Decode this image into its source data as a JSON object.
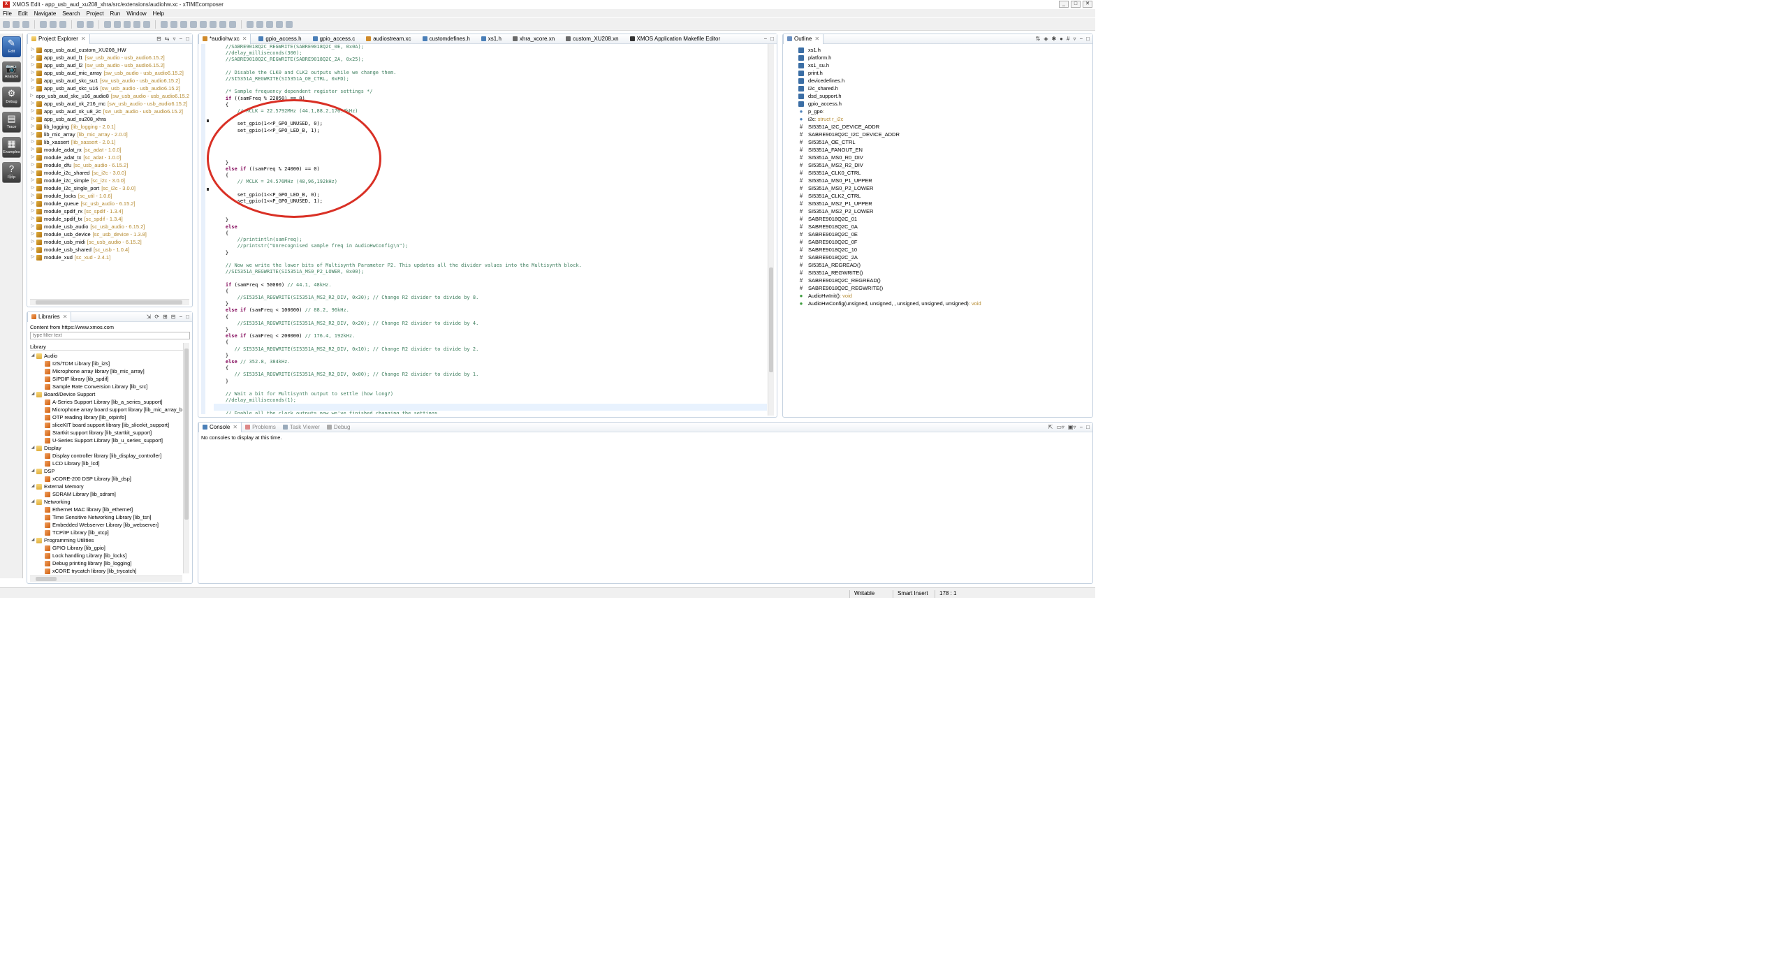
{
  "window": {
    "title": "XMOS Edit - app_usb_aud_xu208_xhra/src/extensions/audiohw.xc - xTIMEcomposer",
    "logo": "X",
    "buttons": [
      "_",
      "□",
      "✕"
    ]
  },
  "menu": [
    "File",
    "Edit",
    "Navigate",
    "Search",
    "Project",
    "Run",
    "Window",
    "Help"
  ],
  "perspectives": [
    {
      "label": "Edit",
      "icon": "✎",
      "active": true
    },
    {
      "label": "Analyze",
      "icon": "📷",
      "active": false
    },
    {
      "label": "Debug",
      "icon": "⚙",
      "active": false
    },
    {
      "label": "Trace",
      "icon": "▤",
      "active": false
    },
    {
      "label": "Examples",
      "icon": "▦",
      "active": false
    },
    {
      "label": "Help",
      "icon": "?",
      "active": false
    }
  ],
  "project_explorer": {
    "title": "Project Explorer",
    "items": [
      {
        "name": "app_usb_aud_custom_XU208_HW",
        "ver": ""
      },
      {
        "name": "app_usb_aud_l1",
        "ver": "[sw_usb_audio - usb_audio6.15.2]"
      },
      {
        "name": "app_usb_aud_l2",
        "ver": "[sw_usb_audio - usb_audio6.15.2]"
      },
      {
        "name": "app_usb_aud_mic_array",
        "ver": "[sw_usb_audio - usb_audio6.15.2]"
      },
      {
        "name": "app_usb_aud_skc_su1",
        "ver": "[sw_usb_audio - usb_audio6.15.2]"
      },
      {
        "name": "app_usb_aud_skc_u16",
        "ver": "[sw_usb_audio - usb_audio6.15.2]"
      },
      {
        "name": "app_usb_aud_skc_u16_audio8",
        "ver": "[sw_usb_audio - usb_audio6.15.2]"
      },
      {
        "name": "app_usb_aud_xk_216_mc",
        "ver": "[sw_usb_audio - usb_audio6.15.2]"
      },
      {
        "name": "app_usb_aud_xk_u8_2c",
        "ver": "[sw_usb_audio - usb_audio6.15.2]"
      },
      {
        "name": "app_usb_aud_xu208_xhra",
        "ver": ""
      },
      {
        "name": "lib_logging",
        "ver": "[lib_logging - 2.0.1]"
      },
      {
        "name": "lib_mic_array",
        "ver": "[lib_mic_array - 2.0.0]"
      },
      {
        "name": "lib_xassert",
        "ver": "[lib_xassert - 2.0.1]"
      },
      {
        "name": "module_adat_rx",
        "ver": "[sc_adat - 1.0.0]"
      },
      {
        "name": "module_adat_tx",
        "ver": "[sc_adat - 1.0.0]"
      },
      {
        "name": "module_dfu",
        "ver": "[sc_usb_audio - 6.15.2]"
      },
      {
        "name": "module_i2c_shared",
        "ver": "[sc_i2c - 3.0.0]"
      },
      {
        "name": "module_i2c_simple",
        "ver": "[sc_i2c - 3.0.0]"
      },
      {
        "name": "module_i2c_single_port",
        "ver": "[sc_i2c - 3.0.0]"
      },
      {
        "name": "module_locks",
        "ver": "[sc_util - 1.0.6]"
      },
      {
        "name": "module_queue",
        "ver": "[sc_usb_audio - 6.15.2]"
      },
      {
        "name": "module_spdif_rx",
        "ver": "[sc_spdif - 1.3.4]"
      },
      {
        "name": "module_spdif_tx",
        "ver": "[sc_spdif - 1.3.4]"
      },
      {
        "name": "module_usb_audio",
        "ver": "[sc_usb_audio - 6.15.2]"
      },
      {
        "name": "module_usb_device",
        "ver": "[sc_usb_device - 1.3.8]"
      },
      {
        "name": "module_usb_midi",
        "ver": "[sc_usb_audio - 6.15.2]"
      },
      {
        "name": "module_usb_shared",
        "ver": "[sc_usb - 1.0.4]"
      },
      {
        "name": "module_xud",
        "ver": "[sc_xud - 2.4.1]"
      }
    ]
  },
  "libraries": {
    "title": "Libraries",
    "content_from": "Content from https://www.xmos.com",
    "filter_placeholder": "type filter text",
    "header": "Library",
    "rows": [
      {
        "level": 0,
        "label": "Audio",
        "folder": true
      },
      {
        "level": 1,
        "label": "I2S/TDM Library [lib_i2s]"
      },
      {
        "level": 1,
        "label": "Microphone array library [lib_mic_array]"
      },
      {
        "level": 1,
        "label": "S/PDIF library [lib_spdif]"
      },
      {
        "level": 1,
        "label": "Sample Rate Conversion Library [lib_src]"
      },
      {
        "level": 0,
        "label": "Board/Device Support",
        "folder": true
      },
      {
        "level": 1,
        "label": "A-Series Support Library [lib_a_series_support]"
      },
      {
        "level": 1,
        "label": "Microphone array board support library [lib_mic_array_b"
      },
      {
        "level": 1,
        "label": "OTP reading library [lib_otpinfo]"
      },
      {
        "level": 1,
        "label": "sliceKIT board support library [lib_slicekit_support]"
      },
      {
        "level": 1,
        "label": "Startkit support library [lib_startkit_support]"
      },
      {
        "level": 1,
        "label": "U-Series Support Library [lib_u_series_support]"
      },
      {
        "level": 0,
        "label": "Display",
        "folder": true
      },
      {
        "level": 1,
        "label": "Display controller library [lib_display_controller]"
      },
      {
        "level": 1,
        "label": "LCD Library [lib_lcd]"
      },
      {
        "level": 0,
        "label": "DSP",
        "folder": true
      },
      {
        "level": 1,
        "label": "xCORE-200 DSP Library [lib_dsp]"
      },
      {
        "level": 0,
        "label": "External Memory",
        "folder": true
      },
      {
        "level": 1,
        "label": "SDRAM Library [lib_sdram]"
      },
      {
        "level": 0,
        "label": "Networking",
        "folder": true
      },
      {
        "level": 1,
        "label": "Ethernet MAC library [lib_ethernet]"
      },
      {
        "level": 1,
        "label": "Time Sensitive Networking Library [lib_tsn]"
      },
      {
        "level": 1,
        "label": "Embedded Webserver Library [lib_webserver]"
      },
      {
        "level": 1,
        "label": "TCP/IP Library [lib_xtcp]"
      },
      {
        "level": 0,
        "label": "Programming Utilities",
        "folder": true
      },
      {
        "level": 1,
        "label": "GPIO Library [lib_gpio]"
      },
      {
        "level": 1,
        "label": "Lock handling Library [lib_locks]"
      },
      {
        "level": 1,
        "label": "Debug printing library [lib_logging]"
      },
      {
        "level": 1,
        "label": "xCORE trycatch library [lib_trycatch]"
      }
    ]
  },
  "editor": {
    "tabs": [
      "*audiohw.xc",
      "gpio_access.h",
      "gpio_access.c",
      "audiostream.xc",
      "customdefines.h",
      "xs1.h",
      "xhra_xcore.xn",
      "custom_XU208.xn",
      "XMOS Application Makefile Editor"
    ],
    "lines": [
      [
        [
          "c",
          "    //SABRE9018Q2C_REGWRITE(SABRE9018Q2C_0E, 0x0A);"
        ]
      ],
      [
        [
          "c",
          "    //delay_milliseconds(300);"
        ]
      ],
      [
        [
          "c",
          "    //SABRE9018Q2C_REGWRITE(SABRE9018Q2C_2A, 0x25);"
        ]
      ],
      [
        [
          "n",
          ""
        ]
      ],
      [
        [
          "c",
          "    // Disable the CLK0 and CLK2 outputs while we change them."
        ]
      ],
      [
        [
          "c",
          "    //SI5351A_REGWRITE(SI5351A_OE_CTRL, 0xFD);"
        ]
      ],
      [
        [
          "n",
          ""
        ]
      ],
      [
        [
          "c",
          "    /* Sample frequency dependent register settings */"
        ]
      ],
      [
        [
          "k",
          "    if"
        ],
        [
          "n",
          " ((samFreq % 22050) == 0)"
        ]
      ],
      [
        [
          "n",
          "    {"
        ]
      ],
      [
        [
          "c",
          "        // MCLK = 22.5792MHz (44.1,88.2,176.4kHz)"
        ]
      ],
      [
        [
          "n",
          ""
        ]
      ],
      [
        [
          "n",
          "        set_gpio(1<<P_GPO_UNUSED, 0);"
        ]
      ],
      [
        [
          "n",
          "        set_gpio(1<<P_GPO_LED_B, 1);"
        ]
      ],
      [
        [
          "n",
          ""
        ]
      ],
      [
        [
          "n",
          ""
        ]
      ],
      [
        [
          "n",
          ""
        ]
      ],
      [
        [
          "n",
          ""
        ]
      ],
      [
        [
          "n",
          "    }"
        ]
      ],
      [
        [
          "k",
          "    else if"
        ],
        [
          "n",
          " ((samFreq % 24000) == 0)"
        ]
      ],
      [
        [
          "n",
          "    {"
        ]
      ],
      [
        [
          "c",
          "        // MCLK = 24.576MHz (48,96,192kHz)"
        ]
      ],
      [
        [
          "n",
          ""
        ]
      ],
      [
        [
          "n",
          "        set_gpio(1<<P_GPO_LED_B, 0);"
        ]
      ],
      [
        [
          "n",
          "        set_gpio(1<<P_GPO_UNUSED, 1);"
        ]
      ],
      [
        [
          "n",
          ""
        ]
      ],
      [
        [
          "n",
          ""
        ]
      ],
      [
        [
          "n",
          "    }"
        ]
      ],
      [
        [
          "k",
          "    else"
        ]
      ],
      [
        [
          "n",
          "    {"
        ]
      ],
      [
        [
          "c",
          "        //printintln(samFreq);"
        ]
      ],
      [
        [
          "c",
          "        //printstr(\"Unrecognised sample freq in AudioHwConfig\\n\");"
        ]
      ],
      [
        [
          "n",
          "    }"
        ]
      ],
      [
        [
          "n",
          ""
        ]
      ],
      [
        [
          "c",
          "    // Now we write the lower bits of Multisynth Parameter P2. This updates all the divider values into the Multisynth block."
        ]
      ],
      [
        [
          "c",
          "    //SI5351A_REGWRITE(SI5351A_MS0_P2_LOWER, 0x00);"
        ]
      ],
      [
        [
          "n",
          ""
        ]
      ],
      [
        [
          "k",
          "    if"
        ],
        [
          "n",
          " (samFreq < 50000) "
        ],
        [
          "c",
          "// 44.1, 48kHz."
        ]
      ],
      [
        [
          "n",
          "    {"
        ]
      ],
      [
        [
          "c",
          "        //SI5351A_REGWRITE(SI5351A_MS2_R2_DIV, 0x30); // Change R2 divider to divide by 8."
        ]
      ],
      [
        [
          "n",
          "    }"
        ]
      ],
      [
        [
          "k",
          "    else if"
        ],
        [
          "n",
          " (samFreq < 100000) "
        ],
        [
          "c",
          "// 88.2, 96kHz."
        ]
      ],
      [
        [
          "n",
          "    {"
        ]
      ],
      [
        [
          "c",
          "        //SI5351A_REGWRITE(SI5351A_MS2_R2_DIV, 0x20); // Change R2 divider to divide by 4."
        ]
      ],
      [
        [
          "n",
          "    }"
        ]
      ],
      [
        [
          "k",
          "    else if"
        ],
        [
          "n",
          " (samFreq < 200000) "
        ],
        [
          "c",
          "// 176.4, 192kHz."
        ]
      ],
      [
        [
          "n",
          "    {"
        ]
      ],
      [
        [
          "c",
          "       // SI5351A_REGWRITE(SI5351A_MS2_R2_DIV, 0x10); // Change R2 divider to divide by 2."
        ]
      ],
      [
        [
          "n",
          "    }"
        ]
      ],
      [
        [
          "k",
          "    else"
        ],
        [
          "n",
          " "
        ],
        [
          "c",
          "// 352.8, 384kHz."
        ]
      ],
      [
        [
          "n",
          "    {"
        ]
      ],
      [
        [
          "c",
          "       // SI5351A_REGWRITE(SI5351A_MS2_R2_DIV, 0x00); // Change R2 divider to divide by 1."
        ]
      ],
      [
        [
          "n",
          "    }"
        ]
      ],
      [
        [
          "n",
          ""
        ]
      ],
      [
        [
          "c",
          "    // Wait a bit for Multisynth output to settle (how long?)"
        ]
      ],
      [
        [
          "c",
          "    //delay_milliseconds(1);"
        ]
      ],
      [
        [
          "n",
          ""
        ]
      ],
      [
        [
          "c",
          "    // Enable all the clock outputs now we've finished changing the settings."
        ]
      ]
    ]
  },
  "outline": {
    "title": "Outline",
    "items": [
      {
        "icon": "h",
        "label": "xs1.h",
        "type": ""
      },
      {
        "icon": "h",
        "label": "platform.h",
        "type": ""
      },
      {
        "icon": "h",
        "label": "xs1_su.h",
        "type": ""
      },
      {
        "icon": "h",
        "label": "print.h",
        "type": ""
      },
      {
        "icon": "h",
        "label": "devicedefines.h",
        "type": ""
      },
      {
        "icon": "h",
        "label": "i2c_shared.h",
        "type": ""
      },
      {
        "icon": "h",
        "label": "dsd_support.h",
        "type": ""
      },
      {
        "icon": "h",
        "label": "gpio_access.h",
        "type": ""
      },
      {
        "icon": "v",
        "label": "p_gpo",
        "type": ": "
      },
      {
        "icon": "v",
        "label": "i2c",
        "type": ": struct r_i2c"
      },
      {
        "icon": "#",
        "label": "SI5351A_I2C_DEVICE_ADDR",
        "type": ""
      },
      {
        "icon": "#",
        "label": "SABRE9018Q2C_I2C_DEVICE_ADDR",
        "type": ""
      },
      {
        "icon": "#",
        "label": "SI5351A_OE_CTRL",
        "type": ""
      },
      {
        "icon": "#",
        "label": "SI5351A_FANOUT_EN",
        "type": ""
      },
      {
        "icon": "#",
        "label": "SI5351A_MS0_R0_DIV",
        "type": ""
      },
      {
        "icon": "#",
        "label": "SI5351A_MS2_R2_DIV",
        "type": ""
      },
      {
        "icon": "#",
        "label": "SI5351A_CLK0_CTRL",
        "type": ""
      },
      {
        "icon": "#",
        "label": "SI5351A_MS0_P1_UPPER",
        "type": ""
      },
      {
        "icon": "#",
        "label": "SI5351A_MS0_P2_LOWER",
        "type": ""
      },
      {
        "icon": "#",
        "label": "SI5351A_CLK2_CTRL",
        "type": ""
      },
      {
        "icon": "#",
        "label": "SI5351A_MS2_P1_UPPER",
        "type": ""
      },
      {
        "icon": "#",
        "label": "SI5351A_MS2_P2_LOWER",
        "type": ""
      },
      {
        "icon": "#",
        "label": "SABRE9018Q2C_01",
        "type": ""
      },
      {
        "icon": "#",
        "label": "SABRE9018Q2C_0A",
        "type": ""
      },
      {
        "icon": "#",
        "label": "SABRE9018Q2C_0E",
        "type": ""
      },
      {
        "icon": "#",
        "label": "SABRE9018Q2C_0F",
        "type": ""
      },
      {
        "icon": "#",
        "label": "SABRE9018Q2C_10",
        "type": ""
      },
      {
        "icon": "#",
        "label": "SABRE9018Q2C_2A",
        "type": ""
      },
      {
        "icon": "#",
        "label": "SI5351A_REGREAD()",
        "type": ""
      },
      {
        "icon": "#",
        "label": "SI5351A_REGWRITE()",
        "type": ""
      },
      {
        "icon": "#",
        "label": "SABRE9018Q2C_REGREAD()",
        "type": ""
      },
      {
        "icon": "#",
        "label": "SABRE9018Q2C_REGWRITE()",
        "type": ""
      },
      {
        "icon": "f",
        "label": "AudioHwInit()",
        "type": ": void"
      },
      {
        "icon": "f",
        "label": "AudioHwConfig(unsigned, unsigned, , unsigned, unsigned, unsigned)",
        "type": ": void"
      }
    ]
  },
  "console": {
    "tabs": [
      "Console",
      "Problems",
      "Task Viewer",
      "Debug"
    ],
    "message": "No consoles to display at this time."
  },
  "status": {
    "writable": "Writable",
    "insert_mode": "Smart Insert",
    "position": "178 : 1"
  },
  "colors": {
    "highlight_circle": "#d93025",
    "comment": "#3f7f5f",
    "keyword": "#7f0055"
  }
}
